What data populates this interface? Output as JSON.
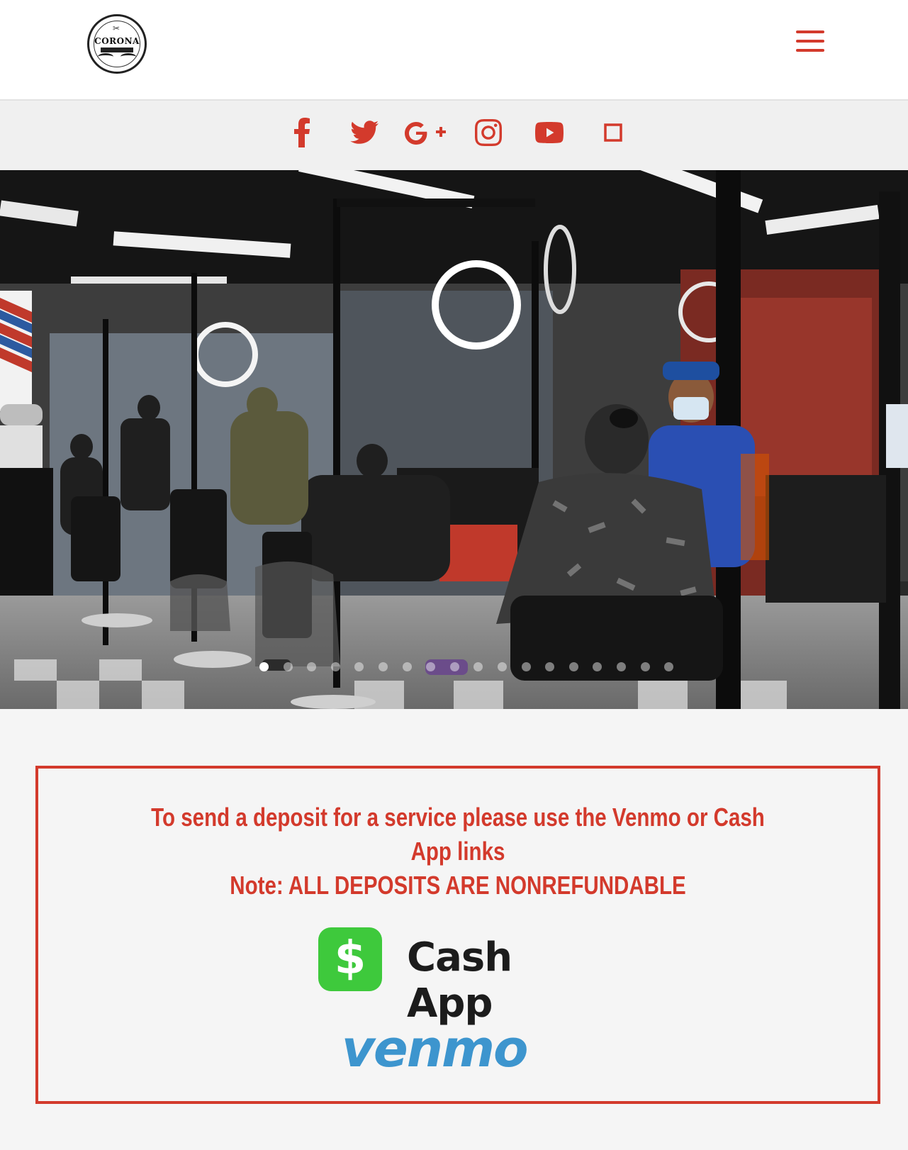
{
  "header": {
    "logo_text": "CORONA",
    "menu_icon": "hamburger-menu-icon"
  },
  "social": [
    {
      "name": "facebook",
      "icon": "facebook-icon"
    },
    {
      "name": "twitter",
      "icon": "twitter-icon"
    },
    {
      "name": "google-plus",
      "icon": "google-plus-icon"
    },
    {
      "name": "instagram",
      "icon": "instagram-icon"
    },
    {
      "name": "youtube",
      "icon": "youtube-icon"
    },
    {
      "name": "unknown",
      "icon": "square-icon"
    }
  ],
  "slider": {
    "slide_count": 18,
    "active_index": 0
  },
  "deposit": {
    "line1": "To send a deposit for a service please use the Venmo or Cash App links",
    "line2": "Note: ALL DEPOSITS ARE NONREFUNDABLE",
    "cashapp_symbol": "$",
    "cashapp_label": "Cash App",
    "venmo_label": "venmo"
  },
  "colors": {
    "accent": "#d33a2c",
    "cashapp_green": "#3ec93c",
    "venmo_blue": "#3d95ce"
  }
}
